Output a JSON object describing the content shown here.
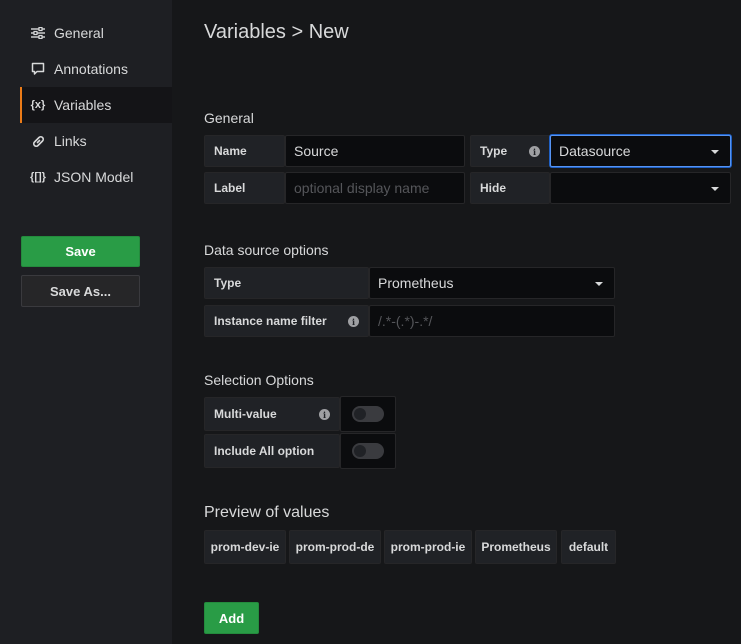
{
  "sidebar": {
    "items": [
      {
        "label": "General",
        "icon": "sliders-icon"
      },
      {
        "label": "Annotations",
        "icon": "comment-icon"
      },
      {
        "label": "Variables",
        "icon": "variable-icon",
        "active": true
      },
      {
        "label": "Links",
        "icon": "link-icon"
      },
      {
        "label": "JSON Model",
        "icon": "json-icon"
      }
    ],
    "save_label": "Save",
    "save_as_label": "Save As..."
  },
  "page": {
    "title": "Variables > New"
  },
  "general": {
    "title": "General",
    "name_label": "Name",
    "name_value": "Source",
    "type_label": "Type",
    "type_value": "Datasource",
    "label_label": "Label",
    "label_placeholder": "optional display name",
    "hide_label": "Hide",
    "hide_value": ""
  },
  "datasource": {
    "title": "Data source options",
    "type_label": "Type",
    "type_value": "Prometheus",
    "filter_label": "Instance name filter",
    "filter_placeholder": "/.*-(.*)-.*/"
  },
  "selection": {
    "title": "Selection Options",
    "multi_label": "Multi-value",
    "multi_enabled": false,
    "include_all_label": "Include All option",
    "include_all_enabled": false
  },
  "preview": {
    "title": "Preview of values",
    "values": [
      "prom-dev-ie",
      "prom-prod-de",
      "prom-prod-ie",
      "Prometheus",
      "default"
    ]
  },
  "add_label": "Add",
  "colors": {
    "accent": "#eb7b18",
    "success": "#299c46",
    "focus": "#5794f2"
  }
}
